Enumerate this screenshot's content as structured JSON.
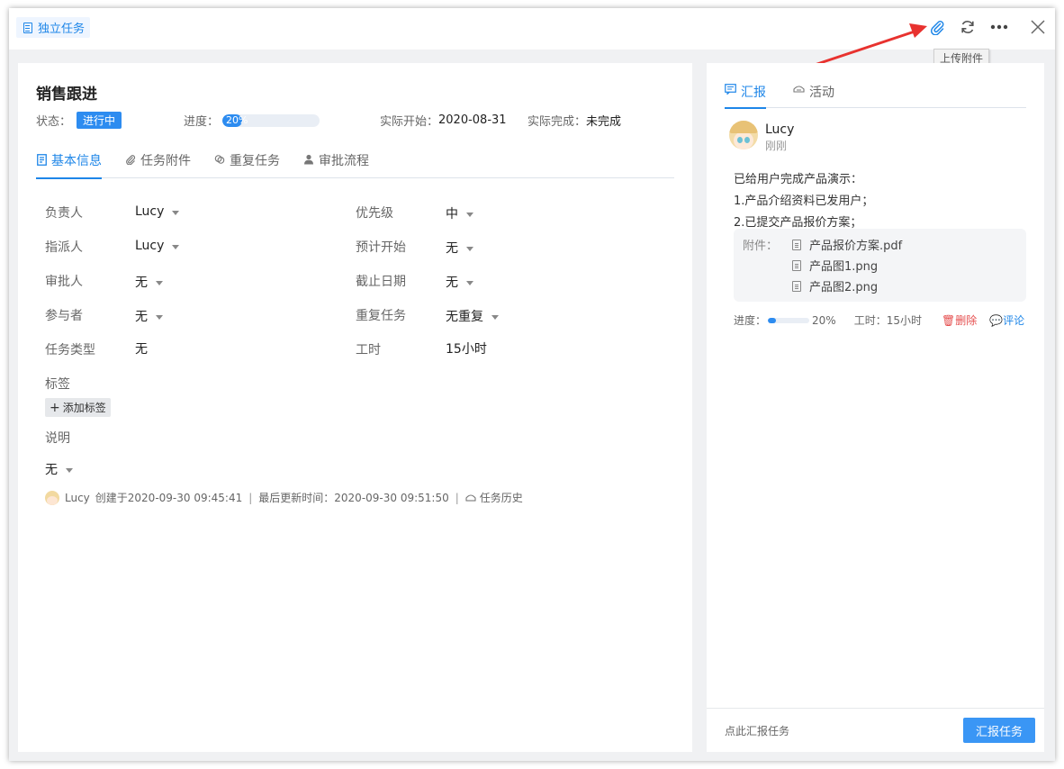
{
  "header": {
    "task_type": "独立任务",
    "tooltip": "上传附件",
    "icons": [
      "paperclip-icon",
      "refresh-icon",
      "more-icon",
      "close-icon"
    ]
  },
  "task": {
    "title": "销售跟进",
    "status_label": "状态：",
    "status": "进行中",
    "progress_label": "进度：",
    "progress_text": "20%",
    "progress_value": 20,
    "actual_start_label": "实际开始：",
    "actual_start": "2020-08-31",
    "actual_finish_label": "实际完成：",
    "actual_finish": "未完成"
  },
  "tabs": [
    {
      "label": "基本信息",
      "icon": "doc-icon"
    },
    {
      "label": "任务附件",
      "icon": "paperclip-icon"
    },
    {
      "label": "重复任务",
      "icon": "link-icon"
    },
    {
      "label": "审批流程",
      "icon": "user-icon"
    }
  ],
  "fields": {
    "owner_label": "负责人",
    "owner": "Lucy",
    "assigner_label": "指派人",
    "assigner": "Lucy",
    "approver_label": "审批人",
    "approver": "无",
    "participants_label": "参与者",
    "participants": "无",
    "task_type_label": "任务类型",
    "task_type": "无",
    "priority_label": "优先级",
    "priority": "中",
    "planned_start_label": "预计开始",
    "planned_start": "无",
    "due_label": "截止日期",
    "due": "无",
    "repeat_label": "重复任务",
    "repeat": "无重复",
    "hours_label": "工时",
    "hours": "15小时"
  },
  "tags": {
    "label": "标签",
    "add": "添加标签"
  },
  "description": {
    "label": "说明",
    "value": "无"
  },
  "footer": {
    "user": "Lucy",
    "created": "创建于2020-09-30 09:45:41",
    "updated": "最后更新时间：2020-09-30 09:51:50",
    "history": "任务历史"
  },
  "right": {
    "tabs": [
      {
        "label": "汇报"
      },
      {
        "label": "活动"
      }
    ],
    "report": {
      "user": "Lucy",
      "time": "刚刚",
      "lines": [
        "已给用户完成产品演示：",
        "1.产品介绍资料已发用户；",
        "2.已提交产品报价方案；"
      ],
      "attach_label": "附件：",
      "attachments": [
        "产品报价方案.pdf",
        "产品图1.png",
        "产品图2.png"
      ],
      "progress_label": "进度：",
      "progress_text": "20%",
      "progress_value": 20,
      "hours": "工时：15小时",
      "delete": "删除",
      "comment": "评论"
    },
    "footer_hint": "点此汇报任务",
    "report_button": "汇报任务"
  },
  "colors": {
    "accent": "#1e86e8",
    "button": "#3a96f5",
    "danger": "#e54d4d",
    "arrow": "#e8322f"
  }
}
